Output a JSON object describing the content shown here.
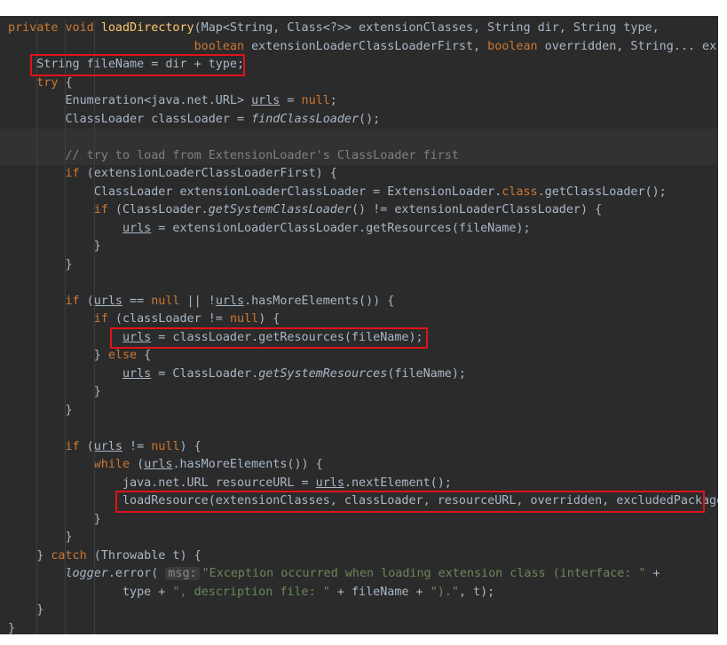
{
  "theme": {
    "background": "#2b2b2b",
    "default_text": "#a9b7c6",
    "keyword": "#cc7832",
    "method_declaration": "#ffc66d",
    "comment": "#808080",
    "string": "#6a8759",
    "highlight_box": "#e0131b"
  },
  "highlight_boxes": [
    {
      "line": 3,
      "description": "String fileName = dir + type;"
    },
    {
      "line": 18,
      "description": "urls = classLoader.getResources(fileName);"
    },
    {
      "line": 27,
      "description": "loadResource(extensionClasses, classLoader, resourceURL, overridden, excludedPackage"
    }
  ],
  "code_lines": [
    [
      {
        "t": "private void ",
        "c": "kw"
      },
      {
        "t": "loadDirectory",
        "c": "fn"
      },
      {
        "t": "(Map<String, Class<?>> extensionClasses, String dir, String type,"
      }
    ],
    [
      {
        "t": "                          "
      },
      {
        "t": "boolean",
        "c": "kw"
      },
      {
        "t": " extensionLoaderClassLoaderFirst, "
      },
      {
        "t": "boolean",
        "c": "kw"
      },
      {
        "t": " overridden, String... ex"
      }
    ],
    [
      {
        "t": "    String fileName = dir + type;"
      }
    ],
    [
      {
        "t": "    "
      },
      {
        "t": "try",
        "c": "kw"
      },
      {
        "t": " {"
      }
    ],
    [
      {
        "t": "        Enumeration<java.net.URL> "
      },
      {
        "t": "urls",
        "c": "un"
      },
      {
        "t": " = "
      },
      {
        "t": "null",
        "c": "kw"
      },
      {
        "t": ";"
      }
    ],
    [
      {
        "t": "        ClassLoader classLoader = "
      },
      {
        "t": "findClassLoader",
        "c": "it"
      },
      {
        "t": "();"
      }
    ],
    [
      {
        "t": ""
      }
    ],
    [
      {
        "t": "        "
      },
      {
        "t": "// try to load from ExtensionLoader's ClassLoader first",
        "c": "cm"
      }
    ],
    [
      {
        "t": "        "
      },
      {
        "t": "if",
        "c": "kw"
      },
      {
        "t": " (extensionLoaderClassLoaderFirst) {"
      }
    ],
    [
      {
        "t": "            ClassLoader extensionLoaderClassLoader = ExtensionLoader."
      },
      {
        "t": "class",
        "c": "kw"
      },
      {
        "t": ".getClassLoader();"
      }
    ],
    [
      {
        "t": "            "
      },
      {
        "t": "if",
        "c": "kw"
      },
      {
        "t": " (ClassLoader."
      },
      {
        "t": "getSystemClassLoader",
        "c": "it"
      },
      {
        "t": "() != extensionLoaderClassLoader) {"
      }
    ],
    [
      {
        "t": "                "
      },
      {
        "t": "urls",
        "c": "un"
      },
      {
        "t": " = extensionLoaderClassLoader.getResources(fileName);"
      }
    ],
    [
      {
        "t": "            }"
      }
    ],
    [
      {
        "t": "        }"
      }
    ],
    [
      {
        "t": ""
      }
    ],
    [
      {
        "t": "        "
      },
      {
        "t": "if",
        "c": "kw"
      },
      {
        "t": " ("
      },
      {
        "t": "urls",
        "c": "un"
      },
      {
        "t": " == "
      },
      {
        "t": "null",
        "c": "kw"
      },
      {
        "t": " || !"
      },
      {
        "t": "urls",
        "c": "un"
      },
      {
        "t": ".hasMoreElements()) {"
      }
    ],
    [
      {
        "t": "            "
      },
      {
        "t": "if",
        "c": "kw"
      },
      {
        "t": " (classLoader != "
      },
      {
        "t": "null",
        "c": "kw"
      },
      {
        "t": ") {"
      }
    ],
    [
      {
        "t": "                "
      },
      {
        "t": "urls",
        "c": "un"
      },
      {
        "t": " = classLoader.getResources(fileName);"
      }
    ],
    [
      {
        "t": "            } "
      },
      {
        "t": "else",
        "c": "kw"
      },
      {
        "t": " {"
      }
    ],
    [
      {
        "t": "                "
      },
      {
        "t": "urls",
        "c": "un"
      },
      {
        "t": " = ClassLoader."
      },
      {
        "t": "getSystemResources",
        "c": "it"
      },
      {
        "t": "(fileName);"
      }
    ],
    [
      {
        "t": "            }"
      }
    ],
    [
      {
        "t": "        }"
      }
    ],
    [
      {
        "t": ""
      }
    ],
    [
      {
        "t": "        "
      },
      {
        "t": "if",
        "c": "kw"
      },
      {
        "t": " ("
      },
      {
        "t": "urls",
        "c": "un"
      },
      {
        "t": " != "
      },
      {
        "t": "null",
        "c": "kw"
      },
      {
        "t": ") {"
      }
    ],
    [
      {
        "t": "            "
      },
      {
        "t": "while",
        "c": "kw"
      },
      {
        "t": " ("
      },
      {
        "t": "urls",
        "c": "un"
      },
      {
        "t": ".hasMoreElements()) {"
      }
    ],
    [
      {
        "t": "                java.net.URL resourceURL = "
      },
      {
        "t": "urls",
        "c": "un"
      },
      {
        "t": ".nextElement();"
      }
    ],
    [
      {
        "t": "                loadResource(extensionClasses, classLoader, resourceURL, overridden, excludedPackage"
      }
    ],
    [
      {
        "t": "            }"
      }
    ],
    [
      {
        "t": "        }"
      }
    ],
    [
      {
        "t": "    } "
      },
      {
        "t": "catch",
        "c": "kw"
      },
      {
        "t": " (Throwable t) {"
      }
    ],
    [
      {
        "t": "        "
      },
      {
        "t": "logger",
        "c": "it"
      },
      {
        "t": ".error( "
      },
      {
        "t": "msg:",
        "c": "hint"
      },
      {
        "t": "\"Exception occurred when loading extension class (interface: \"",
        "c": "st"
      },
      {
        "t": " +"
      }
    ],
    [
      {
        "t": "                type + "
      },
      {
        "t": "\", description file: \"",
        "c": "st"
      },
      {
        "t": " + fileName + "
      },
      {
        "t": "\").\"",
        "c": "st"
      },
      {
        "t": ", t);"
      }
    ],
    [
      {
        "t": "    }"
      }
    ],
    [
      {
        "t": "}"
      }
    ]
  ]
}
